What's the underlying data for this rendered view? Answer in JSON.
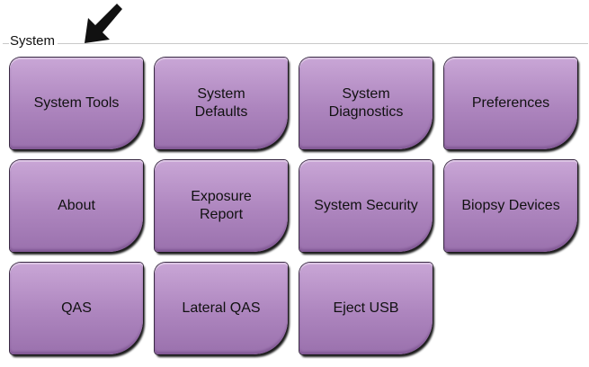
{
  "group": {
    "label": "System"
  },
  "pointer": {
    "icon": "arrow-pointer-icon"
  },
  "tiles": [
    {
      "label": "System Tools"
    },
    {
      "label": "System\nDefaults"
    },
    {
      "label": "System\nDiagnostics"
    },
    {
      "label": "Preferences"
    },
    {
      "label": "About"
    },
    {
      "label": "Exposure\nReport"
    },
    {
      "label": "System Security"
    },
    {
      "label": "Biopsy Devices"
    },
    {
      "label": "QAS"
    },
    {
      "label": "Lateral QAS"
    },
    {
      "label": "Eject USB"
    }
  ],
  "colors": {
    "tile_fill": "#ad85be",
    "tile_border": "#3a2a44",
    "text": "#111111"
  }
}
